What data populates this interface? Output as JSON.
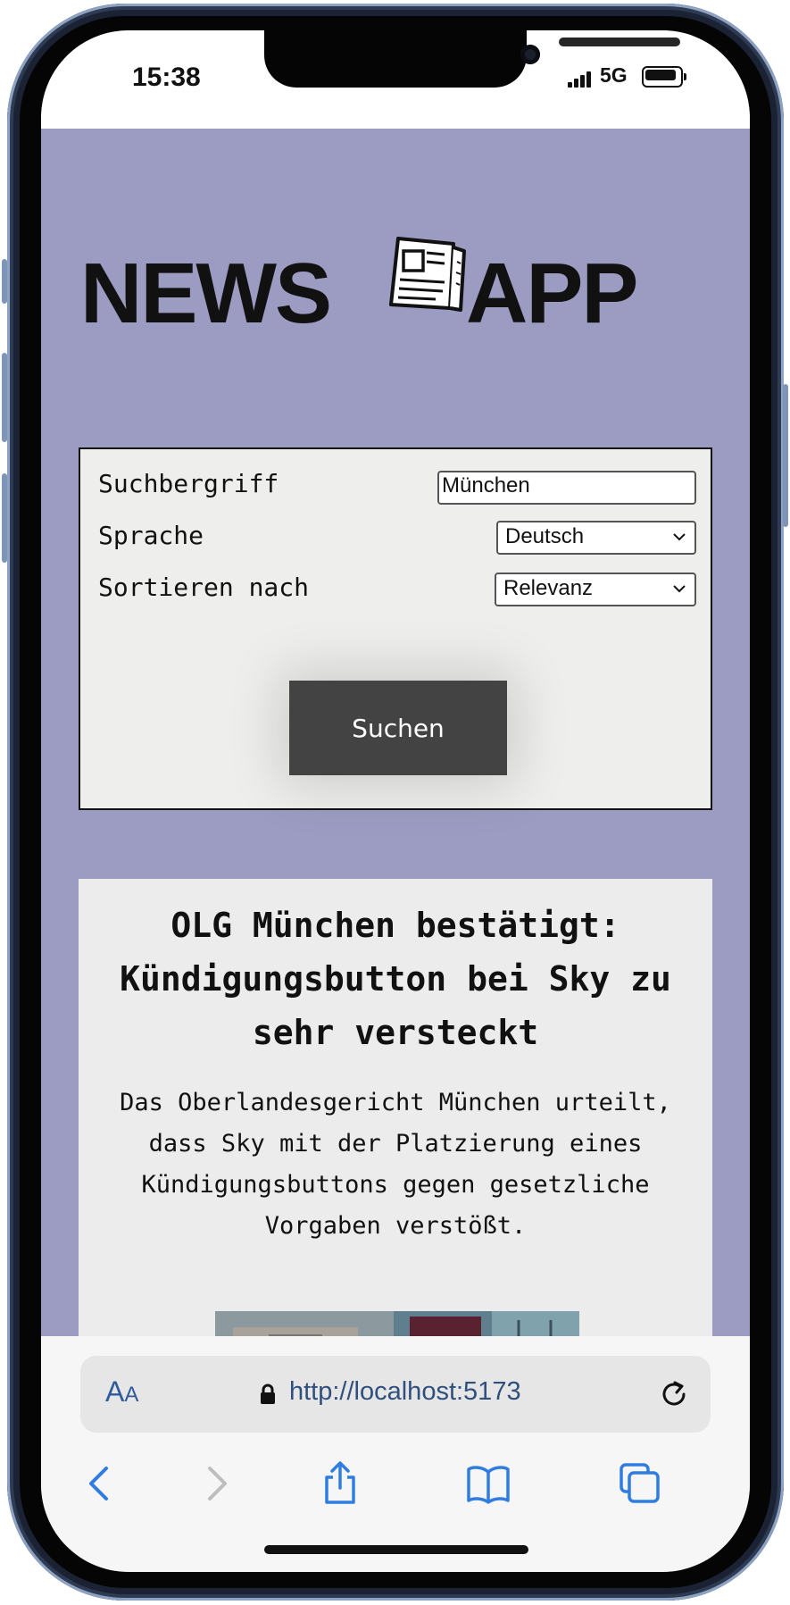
{
  "status": {
    "time": "15:38",
    "network": "5G"
  },
  "header": {
    "left_word": "NEWS",
    "right_word": "APP",
    "logo_icon": "newspaper-icon"
  },
  "search_form": {
    "term_label": "Suchbergriff",
    "term_value": "München",
    "language_label": "Sprache",
    "language_value": "Deutsch",
    "sort_label": "Sortieren nach",
    "sort_value": "Relevanz",
    "submit_label": "Suchen"
  },
  "article": {
    "title": "OLG München bestätigt: Kündigungsbutton bei Sky zu sehr versteckt",
    "description": "Das Oberlandesgericht München urteilt, dass Sky mit der Platzierung eines Kündigungsbuttons gegen gesetzliche Vorgaben verstößt."
  },
  "browser": {
    "text_size_label": "AA",
    "url": "http://localhost:5173",
    "toolbar_icons": [
      "back-icon",
      "forward-icon",
      "share-icon",
      "bookmarks-icon",
      "tabs-icon"
    ]
  },
  "colors": {
    "background": "#9c9bc1",
    "panel": "#eeeeec",
    "button": "#434343",
    "browser_accent": "#2f7de1"
  }
}
